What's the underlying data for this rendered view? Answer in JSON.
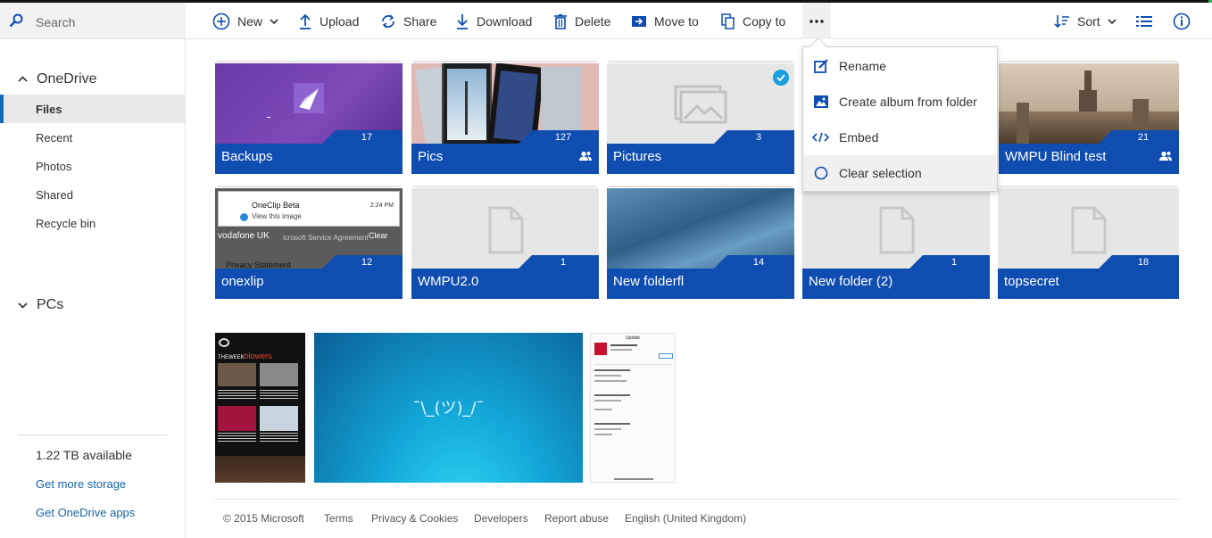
{
  "search": {
    "placeholder": "Search"
  },
  "toolbar": {
    "new": "New",
    "upload": "Upload",
    "share": "Share",
    "download": "Download",
    "delete": "Delete",
    "move_to": "Move to",
    "copy_to": "Copy to",
    "sort": "Sort"
  },
  "sidebar": {
    "onedrive": "OneDrive",
    "items": [
      {
        "label": "Files"
      },
      {
        "label": "Recent"
      },
      {
        "label": "Photos"
      },
      {
        "label": "Shared"
      },
      {
        "label": "Recycle bin"
      }
    ],
    "pcs": "PCs",
    "storage": "1.22 TB available",
    "more_storage": "Get more storage",
    "apps": "Get OneDrive apps"
  },
  "folders": [
    {
      "name": "Backups",
      "count": "17"
    },
    {
      "name": "Pics",
      "count": "127"
    },
    {
      "name": "Pictures",
      "count": "3"
    },
    {
      "name": "WMPU Blind test",
      "count": "21"
    },
    {
      "name": "onexlip",
      "count": "12"
    },
    {
      "name": "WMPU2.0",
      "count": "1"
    },
    {
      "name": "New folderfl",
      "count": "14"
    },
    {
      "name": "New folder (2)",
      "count": "1"
    },
    {
      "name": "topsecret",
      "count": "18"
    }
  ],
  "context_menu": {
    "rename": "Rename",
    "create_album": "Create album from folder",
    "embed": "Embed",
    "clear_selection": "Clear selection"
  },
  "thumb_text": {
    "oneclip_title": "OneClip Beta",
    "oneclip_time": "2:24 PM",
    "oneclip_sub": "View this image",
    "oneclip_carrier": "vodafone UK",
    "oneclip_agreement": "icrosoft Service Agreement",
    "oneclip_clear": "Clear",
    "oneclip_privacy": "Privacy Statement",
    "shrug": "¯\\_(ツ)_/¯",
    "blowers_a": "THEWEEK",
    "blowers_b": "blowers",
    "update": "Update"
  },
  "footer": {
    "copyright": "© 2015 Microsoft",
    "terms": "Terms",
    "privacy": "Privacy & Cookies",
    "developers": "Developers",
    "report": "Report abuse",
    "language": "English (United Kingdom)"
  },
  "colors": {
    "accent": "#0f4db1",
    "link": "#1565a6",
    "selection": "#1b9de2"
  }
}
